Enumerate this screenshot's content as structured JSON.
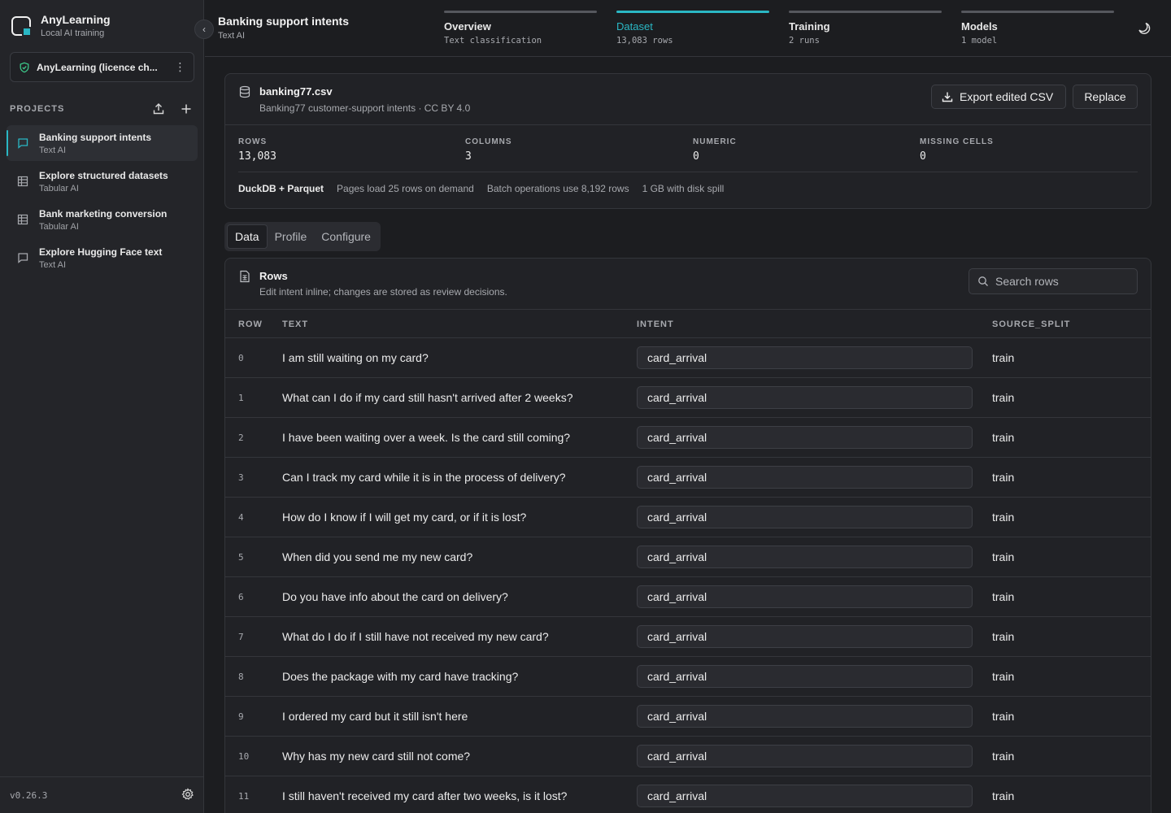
{
  "brand": {
    "name": "AnyLearning",
    "subtitle": "Local AI training"
  },
  "licence": {
    "label": "AnyLearning (licence ch..."
  },
  "projects": {
    "title": "PROJECTS",
    "items": [
      {
        "name": "Banking support intents",
        "type": "Text AI",
        "icon": "chat-bubble-icon",
        "active": true
      },
      {
        "name": "Explore structured datasets",
        "type": "Tabular AI",
        "icon": "table-icon",
        "active": false
      },
      {
        "name": "Bank marketing conversion",
        "type": "Tabular AI",
        "icon": "table-icon",
        "active": false
      },
      {
        "name": "Explore Hugging Face text",
        "type": "Text AI",
        "icon": "chat-bubble-icon",
        "active": false
      }
    ]
  },
  "version": "v0.26.3",
  "header": {
    "title": "Banking support intents",
    "subtitle": "Text AI",
    "steps": [
      {
        "name": "Overview",
        "desc": "Text classification",
        "active": false
      },
      {
        "name": "Dataset",
        "desc": "13,083 rows",
        "active": true
      },
      {
        "name": "Training",
        "desc": "2 runs",
        "active": false
      },
      {
        "name": "Models",
        "desc": "1 model",
        "active": false
      }
    ]
  },
  "dataset": {
    "file_name": "banking77.csv",
    "description": "Banking77 customer-support intents · CC BY 4.0",
    "export_label": "Export edited CSV",
    "replace_label": "Replace",
    "stats": [
      {
        "label": "ROWS",
        "value": "13,083"
      },
      {
        "label": "COLUMNS",
        "value": "3"
      },
      {
        "label": "NUMERIC",
        "value": "0"
      },
      {
        "label": "MISSING CELLS",
        "value": "0"
      }
    ],
    "engine": "DuckDB + Parquet",
    "notes": [
      "Pages load 25 rows on demand",
      "Batch operations use 8,192 rows",
      "1 GB with disk spill"
    ]
  },
  "tabs": [
    {
      "label": "Data",
      "active": true
    },
    {
      "label": "Profile",
      "active": false
    },
    {
      "label": "Configure",
      "active": false
    }
  ],
  "rows": {
    "title": "Rows",
    "description": "Edit intent inline; changes are stored as review decisions.",
    "search_placeholder": "Search rows",
    "columns": [
      "ROW",
      "TEXT",
      "INTENT",
      "SOURCE_SPLIT"
    ],
    "data": [
      {
        "row": "0",
        "text": "I am still waiting on my card?",
        "intent": "card_arrival",
        "split": "train"
      },
      {
        "row": "1",
        "text": "What can I do if my card still hasn't arrived after 2 weeks?",
        "intent": "card_arrival",
        "split": "train"
      },
      {
        "row": "2",
        "text": "I have been waiting over a week. Is the card still coming?",
        "intent": "card_arrival",
        "split": "train"
      },
      {
        "row": "3",
        "text": "Can I track my card while it is in the process of delivery?",
        "intent": "card_arrival",
        "split": "train"
      },
      {
        "row": "4",
        "text": "How do I know if I will get my card, or if it is lost?",
        "intent": "card_arrival",
        "split": "train"
      },
      {
        "row": "5",
        "text": "When did you send me my new card?",
        "intent": "card_arrival",
        "split": "train"
      },
      {
        "row": "6",
        "text": "Do you have info about the card on delivery?",
        "intent": "card_arrival",
        "split": "train"
      },
      {
        "row": "7",
        "text": "What do I do if I still have not received my new card?",
        "intent": "card_arrival",
        "split": "train"
      },
      {
        "row": "8",
        "text": "Does the package with my card have tracking?",
        "intent": "card_arrival",
        "split": "train"
      },
      {
        "row": "9",
        "text": "I ordered my card but it still isn't here",
        "intent": "card_arrival",
        "split": "train"
      },
      {
        "row": "10",
        "text": "Why has my new card still not come?",
        "intent": "card_arrival",
        "split": "train"
      },
      {
        "row": "11",
        "text": "I still haven't received my card after two weeks, is it lost?",
        "intent": "card_arrival",
        "split": "train"
      }
    ]
  },
  "colors": {
    "accent": "#2ab7c4",
    "background": "#1c1d20",
    "sidebar": "#242529",
    "licence_shield": "#3ecf8e"
  }
}
